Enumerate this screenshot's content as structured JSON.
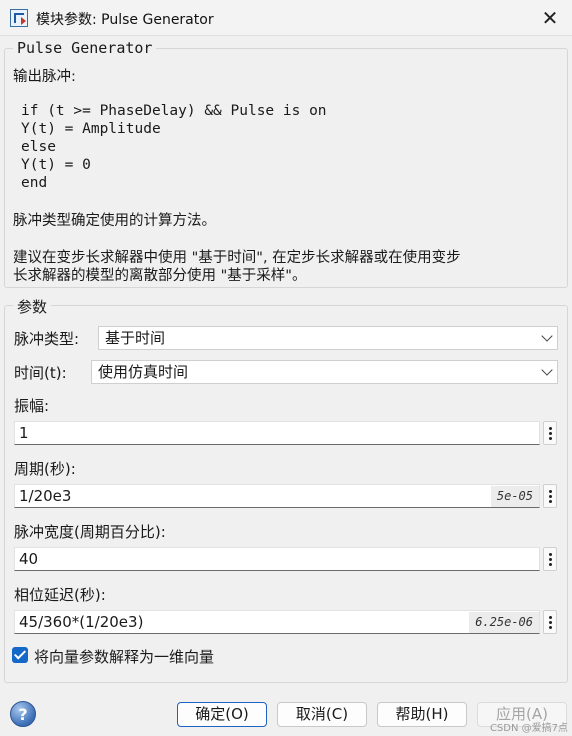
{
  "window": {
    "title": "模块参数: Pulse Generator",
    "close_glyph": "✕"
  },
  "description": {
    "legend": "Pulse Generator",
    "intro": "输出脉冲:",
    "code": [
      "if (t >= PhaseDelay) && Pulse is on",
      "Y(t) = Amplitude",
      "else",
      "Y(t) = 0",
      "end"
    ],
    "note1": "脉冲类型确定使用的计算方法。",
    "note2_line1": "建议在变步长求解器中使用 \"基于时间\", 在定步长求解器或在使用变步",
    "note2_line2": "长求解器的模型的离散部分使用 \"基于采样\"。"
  },
  "params": {
    "legend": "参数",
    "pulse_type": {
      "label": "脉冲类型:",
      "value": "基于时间"
    },
    "time": {
      "label": "时间(t):",
      "value": "使用仿真时间"
    },
    "amplitude": {
      "label": "振幅:",
      "value": "1"
    },
    "period": {
      "label": "周期(秒):",
      "value": "1/20e3",
      "evaluated": "5e-05"
    },
    "pulse_width": {
      "label": "脉冲宽度(周期百分比):",
      "value": "40"
    },
    "phase_delay": {
      "label": "相位延迟(秒):",
      "value": "45/360*(1/20e3)",
      "evaluated": "6.25e-06"
    },
    "vector_checkbox": {
      "label": "将向量参数解释为一维向量",
      "checked": true
    }
  },
  "buttons": {
    "help_glyph": "?",
    "ok": "确定(O)",
    "cancel": "取消(C)",
    "help": "帮助(H)",
    "apply": "应用(A)"
  },
  "watermark": "CSDN @爱搞7点",
  "colors": {
    "accent": "#1468c7",
    "primary_border": "#1e63c3"
  }
}
